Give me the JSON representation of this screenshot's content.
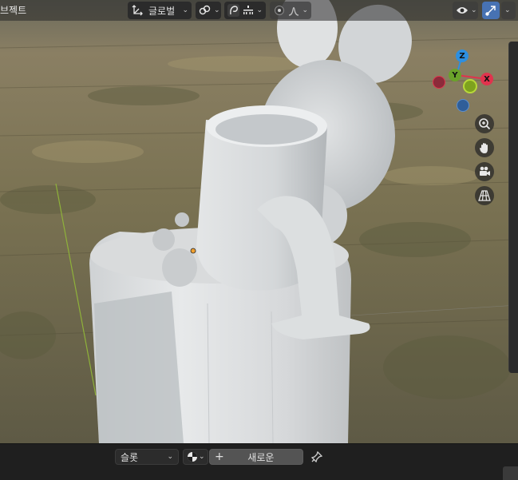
{
  "header": {
    "object_label": "브젝트",
    "transform_orientation": "글로벌",
    "icons": [
      "transform-pivot-icon",
      "snap-icon",
      "proportional-edit-icon",
      "falloff-icon",
      "visibility-icon",
      "gizmo-toggle-icon"
    ]
  },
  "gizmo": {
    "axis_z": "Z",
    "axis_y": "Y",
    "axis_x": "X",
    "colors": {
      "x": "#e0334d",
      "y": "#6aa22a",
      "z": "#2d8fe0",
      "neg_x": "#8c2a3a",
      "neg_y": "#9bbf2a",
      "neg_z": "#2f5e99"
    }
  },
  "navigation": [
    "zoom-icon",
    "hand-pan-icon",
    "camera-icon",
    "perspective-grid-icon"
  ],
  "bottom_bar": {
    "slot_label": "슬롯",
    "new_button_label": "새로운",
    "plus_label": "+",
    "pin_icon": "pin-icon",
    "material_icon": "material-sphere-icon"
  }
}
